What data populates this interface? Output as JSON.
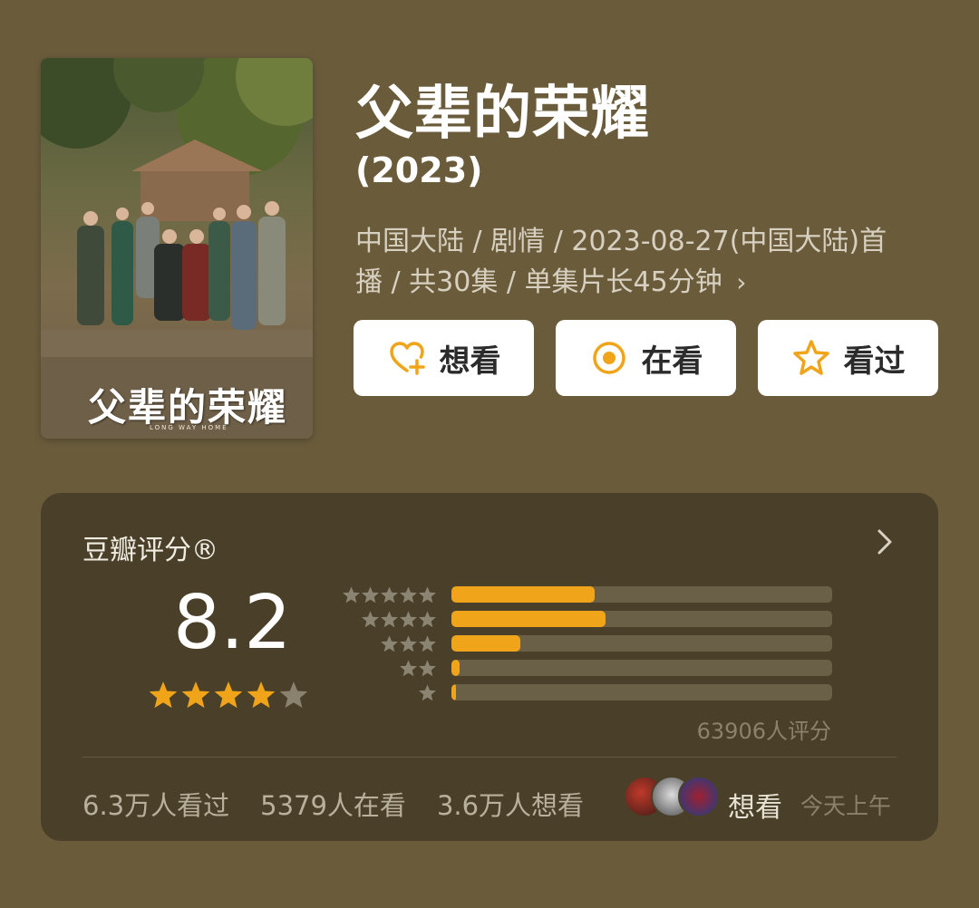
{
  "poster": {
    "title_art": "父辈的荣耀",
    "subtitle_art": "LONG WAY HOME"
  },
  "header": {
    "title": "父辈的荣耀",
    "year": "(2023)",
    "meta_line1": "中国大陆 / 剧情 / 2023-08-27(中国大陆)首",
    "meta_line2": "播 / 共30集 / 单集片长45分钟",
    "meta_chevron": "›"
  },
  "actions": {
    "want": {
      "label": "想看",
      "icon": "heart-plus-icon"
    },
    "watching": {
      "label": "在看",
      "icon": "target-icon"
    },
    "watched": {
      "label": "看过",
      "icon": "star-outline-icon"
    }
  },
  "rating": {
    "title": "豆瓣评分®",
    "score": "8.2",
    "score_stars": 4,
    "distribution": [
      {
        "stars": 5,
        "fraction": 0.376
      },
      {
        "stars": 4,
        "fraction": 0.405
      },
      {
        "stars": 3,
        "fraction": 0.181
      },
      {
        "stars": 2,
        "fraction": 0.021
      },
      {
        "stars": 1,
        "fraction": 0.012
      }
    ],
    "count_text": "63906人评分"
  },
  "stats": {
    "watched": "6.3万人看过",
    "watching": "5379人在看",
    "want": "3.6万人想看",
    "friend_action": "想看",
    "friend_time": "今天上午"
  },
  "colors": {
    "background": "#6a5c3b",
    "card": "#4a4029",
    "accent": "#f0a41a",
    "bar_track": "#6a5f47"
  }
}
